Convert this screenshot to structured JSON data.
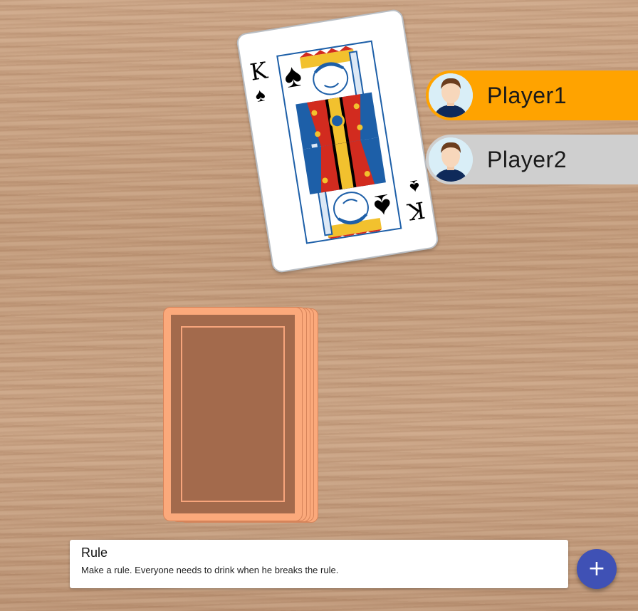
{
  "current_card": {
    "rank": "K",
    "suit_symbol": "♠",
    "suit_name": "spades",
    "face_color": "#ffffff",
    "court_colors": [
      "#1d5fa8",
      "#d22b1f",
      "#f2c12e",
      "#000000"
    ]
  },
  "deck": {
    "back_color": "#a36a4c",
    "edge_color": "#fba97b"
  },
  "players": [
    {
      "name": "Player1",
      "active": true,
      "color": "#ffa300"
    },
    {
      "name": "Player2",
      "active": false,
      "color": "#cfcfcf"
    }
  ],
  "rule": {
    "title": "Rule",
    "text": "Make a rule. Everyone needs to drink when he breaks the rule."
  },
  "fab": {
    "label": "+",
    "icon": "plus-icon",
    "color": "#3f51b5"
  }
}
